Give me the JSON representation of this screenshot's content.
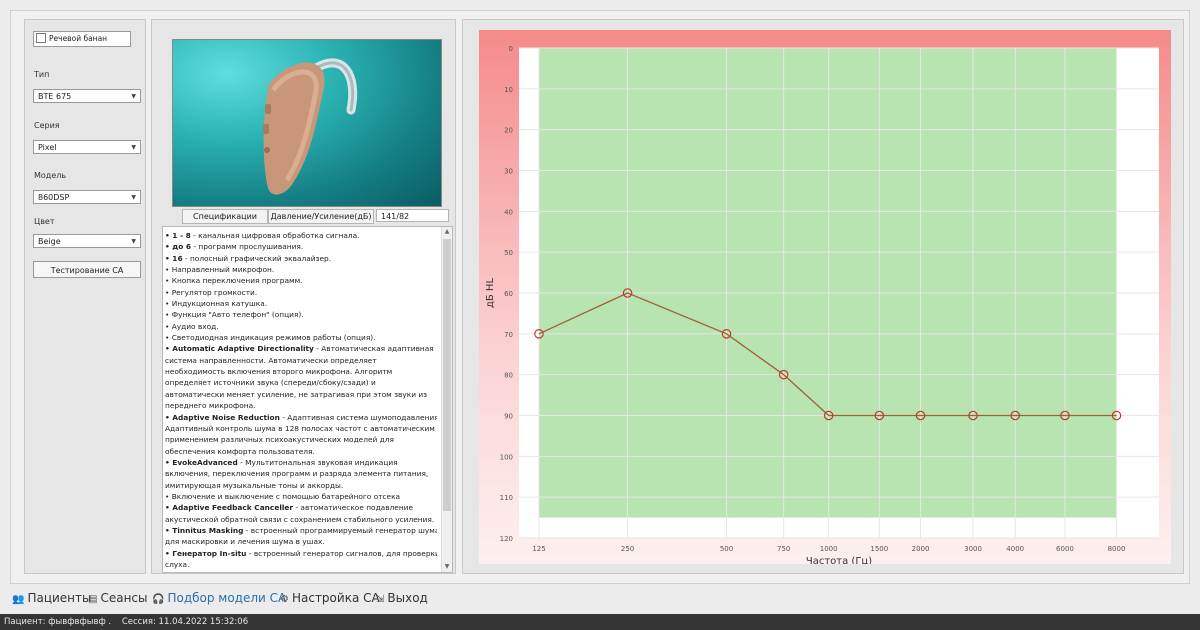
{
  "left": {
    "speech_bank": "Речевой банан",
    "type_label": "Тип",
    "type_value": "BTE 675",
    "series_label": "Серия",
    "series_value": "Pixel",
    "model_label": "Модель",
    "model_value": "860DSP",
    "color_label": "Цвет",
    "color_value": "Beige",
    "test_button": "Тестирование СА"
  },
  "middle": {
    "tab_spec": "Спецификации",
    "tab_pressure": "Давление/Усиление(дБ)",
    "pressure_value": "141/82",
    "spec_lines": [
      [
        {
          "b": "• 1 - 8"
        },
        {
          "t": " - канальная цифровая обработка сигнала."
        }
      ],
      [
        {
          "b": "• до 6"
        },
        {
          "t": " - программ прослушивания."
        }
      ],
      [
        {
          "b": "• 16"
        },
        {
          "t": " - полосный графический эквалайзер."
        }
      ],
      [
        {
          "t": "• Направленный микрофон."
        }
      ],
      [
        {
          "t": "• Кнопка переключения программ."
        }
      ],
      [
        {
          "t": "• Регулятор громкости."
        }
      ],
      [
        {
          "t": "• Индукционная катушка."
        }
      ],
      [
        {
          "t": "• Функция \"Авто телефон\" (опция)."
        }
      ],
      [
        {
          "t": "• Аудио вход."
        }
      ],
      [
        {
          "t": "• Светодиодная индикация режимов работы (опция)."
        }
      ],
      [
        {
          "b": "• Automatic Adaptive Directionality"
        },
        {
          "t": " - Автоматическая адаптивная"
        }
      ],
      [
        {
          "t": "система направленности. Автоматически определяет"
        }
      ],
      [
        {
          "t": "необходимость включения второго микрофона. Алгоритм"
        }
      ],
      [
        {
          "t": "определяет источники звука (спереди/сбоку/сзади) и"
        }
      ],
      [
        {
          "t": "автоматически меняет усиление, не затрагивая при этом звуки из"
        }
      ],
      [
        {
          "t": "переднего микрофона."
        }
      ],
      [
        {
          "b": "• Adaptive Noise Reduction"
        },
        {
          "t": " - Адаптивная система шумоподавления."
        }
      ],
      [
        {
          "t": "Адаптивный контроль шума в 128 полосах частот с автоматическим"
        }
      ],
      [
        {
          "t": "применением различных психоакустических моделей для"
        }
      ],
      [
        {
          "t": "обеспечения комфорта пользователя."
        }
      ],
      [
        {
          "b": "• EvokeAdvanced"
        },
        {
          "t": " - Мультитональная звуковая индикация"
        }
      ],
      [
        {
          "t": "включения, переключения программ и разряда элемента питания,"
        }
      ],
      [
        {
          "t": "имитирующая музыкальные тоны и аккорды."
        }
      ],
      [
        {
          "t": "• Включение и выключение с помощью батарейного отсека"
        }
      ],
      [
        {
          "b": "• Adaptive Feedback Canceller"
        },
        {
          "t": " - автоматическое подавление"
        }
      ],
      [
        {
          "t": "акустической обратной связи с сохранением стабильного усиления."
        }
      ],
      [
        {
          "b": "• Tinnitus Masking"
        },
        {
          "t": " - встроенный программируемый генератор шума"
        }
      ],
      [
        {
          "t": "для маскировки и лечения шума в ушах."
        }
      ],
      [
        {
          "b": "• Генератор In-situ"
        },
        {
          "t": " - встроенный генератор сигналов, для проверки"
        }
      ],
      [
        {
          "t": "слуха."
        }
      ]
    ]
  },
  "chart_data": {
    "type": "line",
    "xlabel": "Частота (Гц)",
    "ylabel": "дБ HL",
    "x_ticks": [
      "125",
      "250",
      "500",
      "750",
      "1000",
      "1500",
      "2000",
      "3000",
      "4000",
      "6000",
      "8000"
    ],
    "y_ticks": [
      "0",
      "10",
      "20",
      "30",
      "40",
      "50",
      "60",
      "70",
      "80",
      "90",
      "100",
      "110",
      "120"
    ],
    "ylim": [
      0,
      120
    ],
    "y_inverted": true,
    "x_scale": "log",
    "series": [
      {
        "x": [
          125,
          250,
          500,
          750,
          1000,
          1500,
          2000,
          3000,
          4000,
          6000,
          8000
        ],
        "y": [
          70,
          60,
          70,
          80,
          90,
          90,
          90,
          90,
          90,
          90,
          90
        ]
      }
    ],
    "fitting_range": {
      "x": [
        125,
        8000
      ],
      "y": [
        0,
        115
      ]
    },
    "colors": {
      "line": "#a0603a",
      "range": "#b7e4b0",
      "background_top": "#f9b0b0",
      "grid": "#ffffff"
    }
  },
  "nav": [
    {
      "label": "Пациенты",
      "icon": "patients-icon",
      "active": false
    },
    {
      "label": "Сеансы",
      "icon": "sessions-icon",
      "active": false
    },
    {
      "label": "Подбор модели СА",
      "icon": "headphones-icon",
      "active": true
    },
    {
      "label": "Настройка СА",
      "icon": "settings-icon",
      "active": false
    },
    {
      "label": "Выход",
      "icon": "exit-icon",
      "active": false
    }
  ],
  "status": {
    "patient": "Пациент: фывфвфывф .",
    "session": "Сессия: 11.04.2022 15:32:06"
  }
}
